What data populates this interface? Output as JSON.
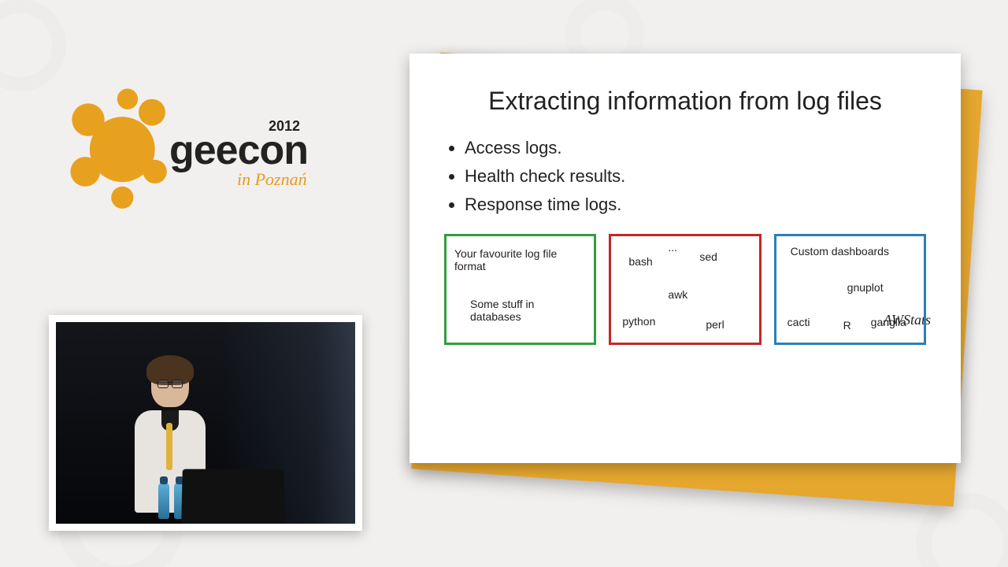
{
  "logo": {
    "year": "2012",
    "name": "geecon",
    "subtitle": "in Poznań"
  },
  "slide": {
    "title": "Extracting information from log files",
    "bullets": [
      "Access logs.",
      "Health check results.",
      "Response time logs."
    ],
    "awstats_label": "AWStats",
    "box_green": {
      "line1": "Your favourite log file format",
      "line2": "Some stuff in databases"
    },
    "box_red": {
      "dots": "...",
      "t1": "bash",
      "t2": "sed",
      "t3": "awk",
      "t4": "python",
      "t5": "perl"
    },
    "box_blue": {
      "t1": "Custom dashboards",
      "t2": "gnuplot",
      "t3": "cacti",
      "t4": "R",
      "t5": "ganglia"
    }
  }
}
